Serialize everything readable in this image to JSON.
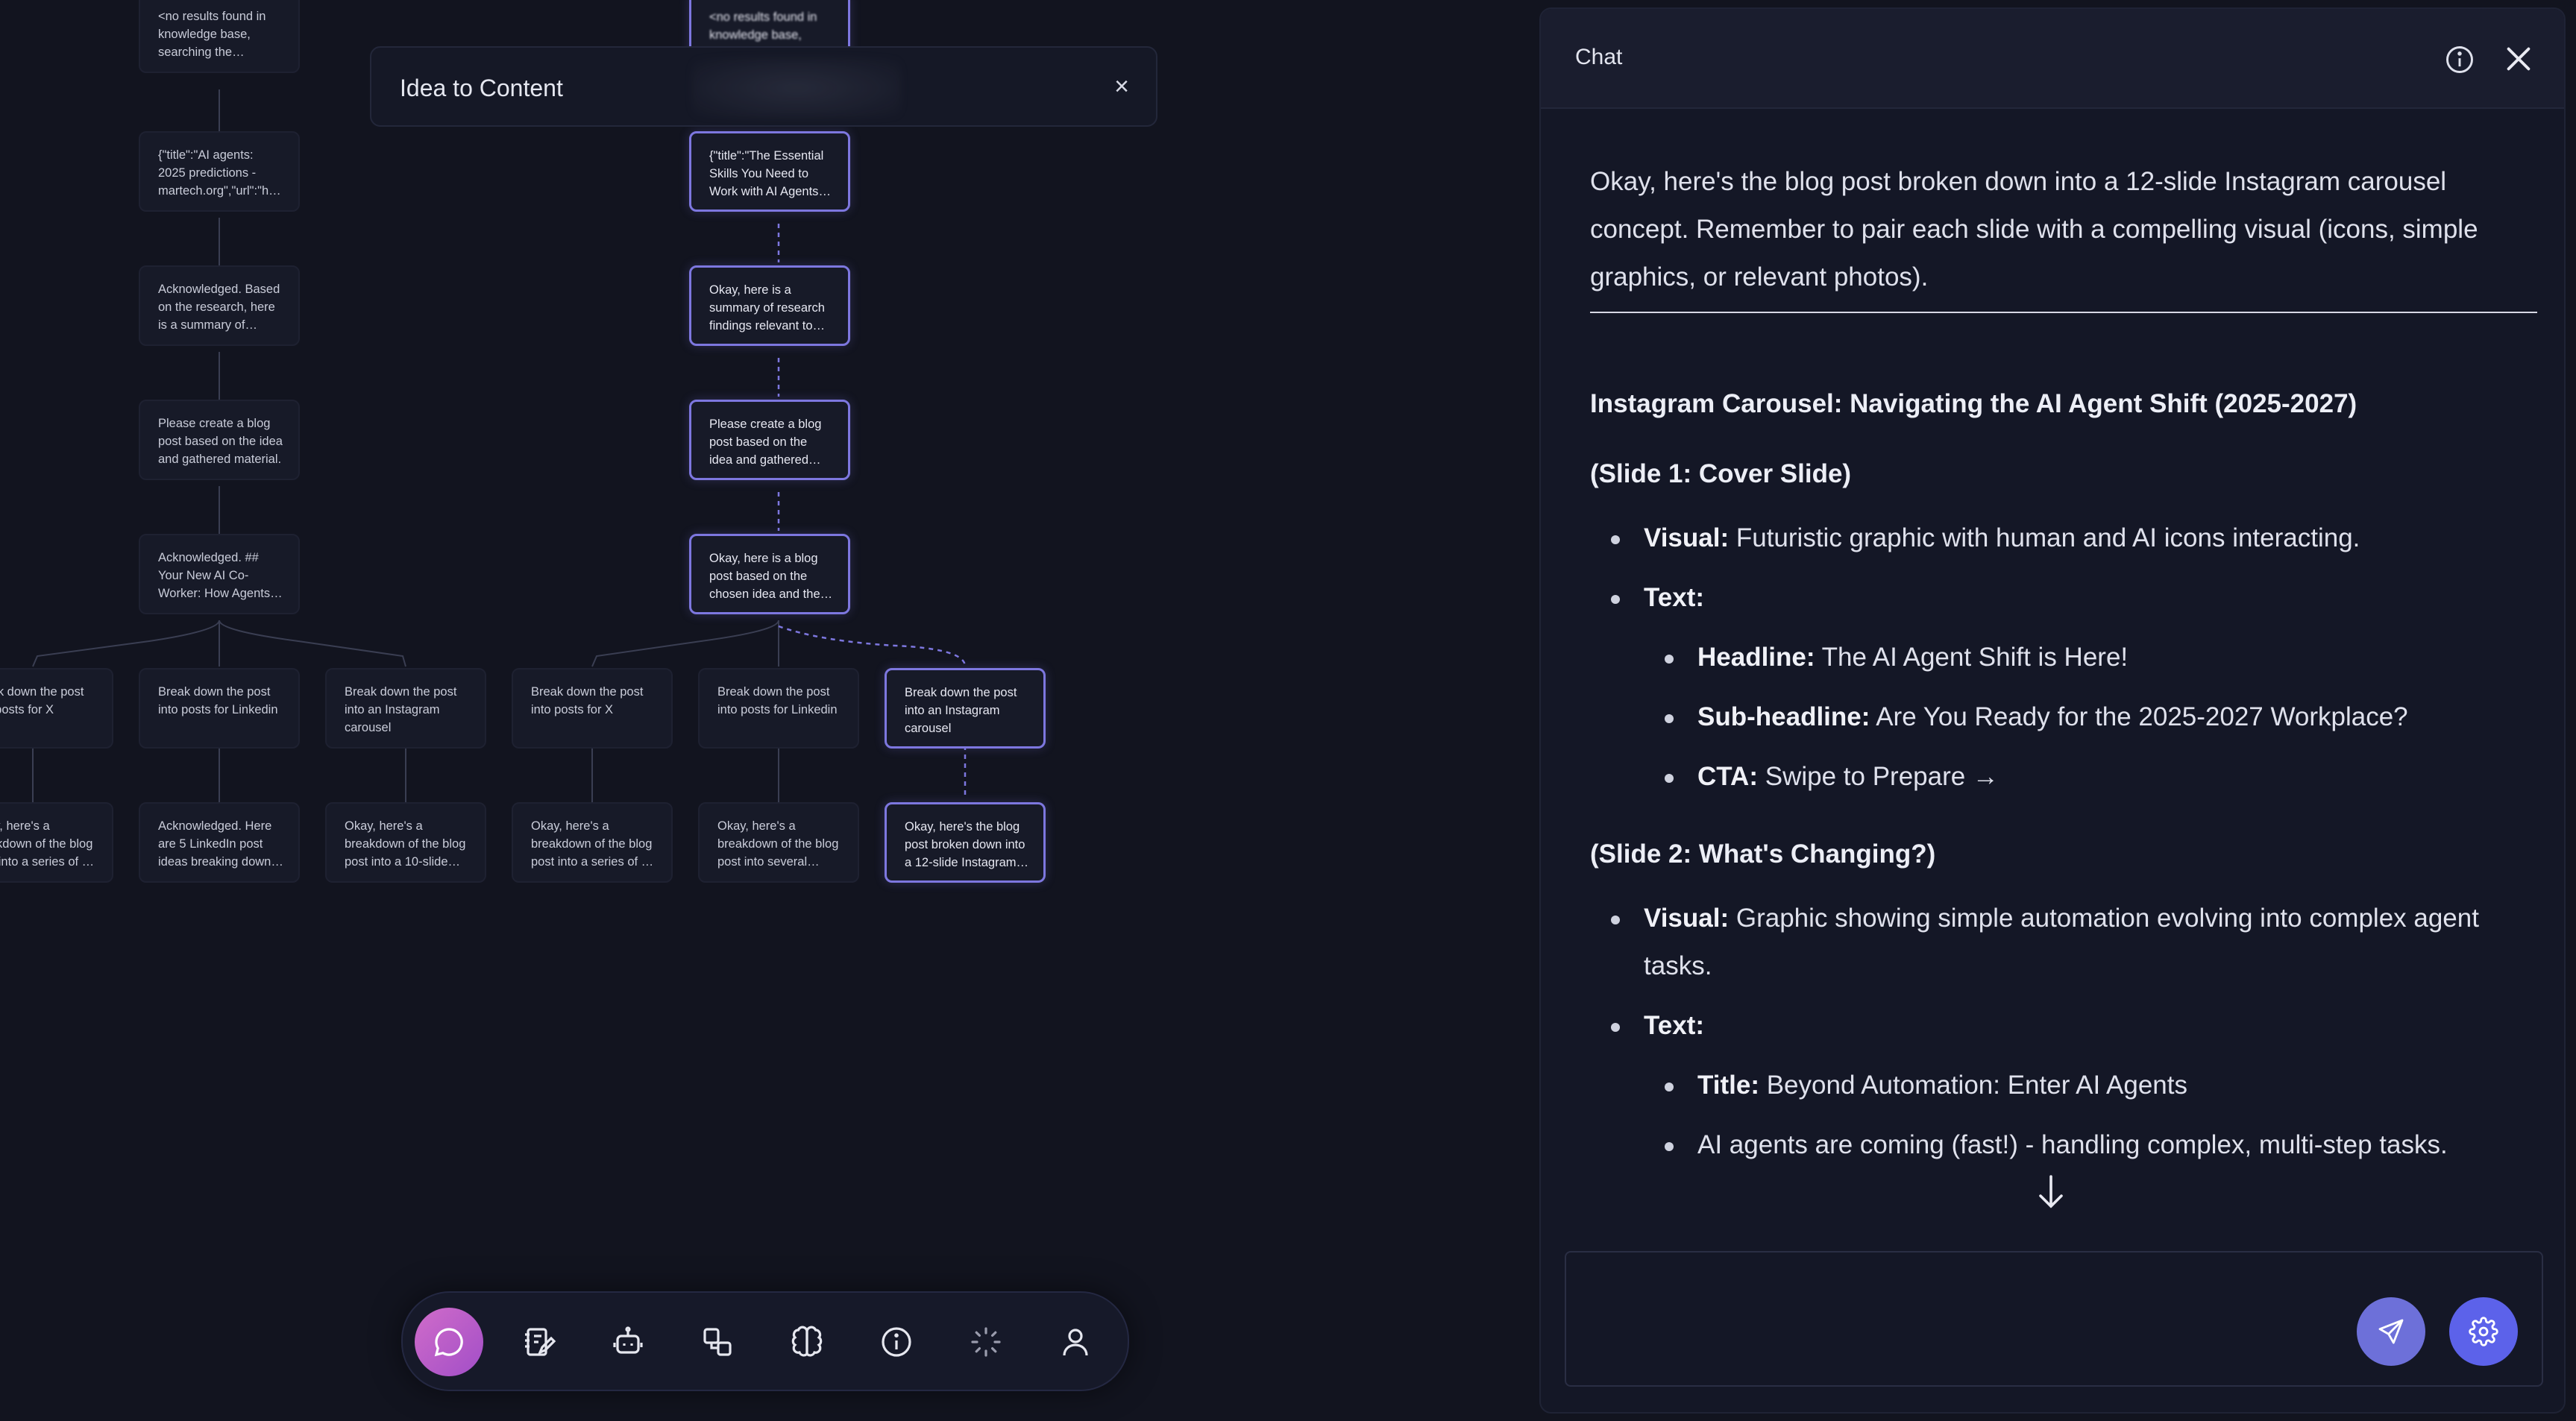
{
  "canvas": {
    "nodes": [
      {
        "id": "n1",
        "text": "<no results found in knowledge base, searching the internet...>...",
        "active": false,
        "blur": false
      },
      {
        "id": "n2",
        "text": "<no results found in knowledge base, searching the internet...>",
        "active": true,
        "blur": true
      },
      {
        "id": "n3",
        "text": "{\"title\":\"AI agents: 2025 predictions - martech.org\",\"url\":\"https:...",
        "active": false,
        "blur": false
      },
      {
        "id": "n4",
        "text": "{\"title\":\"The Essential Skills You Need to Work with AI Agents -...",
        "active": true,
        "blur": false
      },
      {
        "id": "n5",
        "text": "Acknowledged. Based on the research, here is a summary of materials...",
        "active": false,
        "blur": false
      },
      {
        "id": "n6",
        "text": "Okay, here is a summary of research findings relevant to the blog pos...",
        "active": true,
        "blur": false
      },
      {
        "id": "n7",
        "text": "Please create a blog post based on the idea and gathered material.",
        "active": false,
        "blur": false
      },
      {
        "id": "n8",
        "text": "Please create a blog post based on the idea and gathered material.",
        "active": true,
        "blur": false
      },
      {
        "id": "n9",
        "text": "Acknowledged. ## Your New AI Co-Worker: How Agents Will Augment (N...",
        "active": false,
        "blur": false
      },
      {
        "id": "n10",
        "text": "Okay, here is a blog post based on the chosen idea and the gathered...",
        "active": true,
        "blur": false
      },
      {
        "id": "n11",
        "text": "Break down the post into posts for X",
        "active": false,
        "blur": false
      },
      {
        "id": "n12",
        "text": "Break down the post into posts for Linkedin",
        "active": false,
        "blur": false
      },
      {
        "id": "n13",
        "text": "Break down the post into an Instagram carousel",
        "active": false,
        "blur": false
      },
      {
        "id": "n14",
        "text": "Break down the post into posts for X",
        "active": false,
        "blur": false
      },
      {
        "id": "n15",
        "text": "Break down the post into posts for Linkedin",
        "active": false,
        "blur": false
      },
      {
        "id": "n16",
        "text": "Break down the post into an Instagram carousel",
        "active": true,
        "blur": false
      },
      {
        "id": "n17",
        "text": "Okay, here's a breakdown of the blog post into a series of X (formerly...",
        "active": false,
        "blur": false
      },
      {
        "id": "n18",
        "text": "Acknowledged. Here are 5 LinkedIn post ideas breaking down the blog...",
        "active": false,
        "blur": false
      },
      {
        "id": "n19",
        "text": "Okay, here's a breakdown of the blog post into a 10-slide Instagram carousel...",
        "active": false,
        "blur": false
      },
      {
        "id": "n20",
        "text": "Okay, here's a breakdown of the blog post into a series of X (formerly...",
        "active": false,
        "blur": false
      },
      {
        "id": "n21",
        "text": "Okay, here's a breakdown of the blog post into several distinct LinkedIn...",
        "active": false,
        "blur": false
      },
      {
        "id": "n22",
        "text": "Okay, here's the blog post broken down into a 12-slide Instagram carouse...",
        "active": true,
        "blur": false
      }
    ]
  },
  "idea_panel": {
    "title": "Idea to Content",
    "close_glyph": "×"
  },
  "dock": {
    "icons": [
      "chat-bubble-icon",
      "notebook-edit-icon",
      "robot-icon",
      "shapes-icon",
      "brain-icon",
      "info-icon",
      "loading-spinner-icon",
      "user-icon"
    ],
    "active_icon": "chat-bubble-icon",
    "active_gradient": [
      "#d06cc9",
      "#a24ec8"
    ]
  },
  "chat": {
    "title": "Chat",
    "intro": "Okay, here's the blog post broken down into a 12-slide Instagram carousel concept. Remember to pair each slide with a compelling visual (icons, simple graphics, or relevant photos).",
    "carousel_title": "Instagram Carousel: Navigating the AI Agent Shift (2025-2027)",
    "slide1": {
      "title": "(Slide 1: Cover Slide)",
      "visual_label": "Visual:",
      "visual_text": " Futuristic graphic with human and AI icons interacting.",
      "text_label": "Text:",
      "headline_label": "Headline:",
      "headline_text": " The AI Agent Shift is Here!",
      "subheadline_label": "Sub-headline:",
      "subheadline_text": " Are You Ready for the 2025-2027 Workplace?",
      "cta_label": "CTA:",
      "cta_text": " Swipe to Prepare →"
    },
    "slide2": {
      "title": "(Slide 2: What's Changing?)",
      "visual_label": "Visual:",
      "visual_text": " Graphic showing simple automation evolving into complex agent tasks.",
      "text_label": "Text:",
      "title_label": "Title:",
      "title_text": " Beyond Automation: Enter AI Agents",
      "bullet_text": "AI agents are coming (fast!) - handling complex, multi-step tasks."
    },
    "composer": {
      "value": "",
      "placeholder": ""
    },
    "accent_send": "#6d70d9",
    "accent_settings": "#5c62ea"
  }
}
